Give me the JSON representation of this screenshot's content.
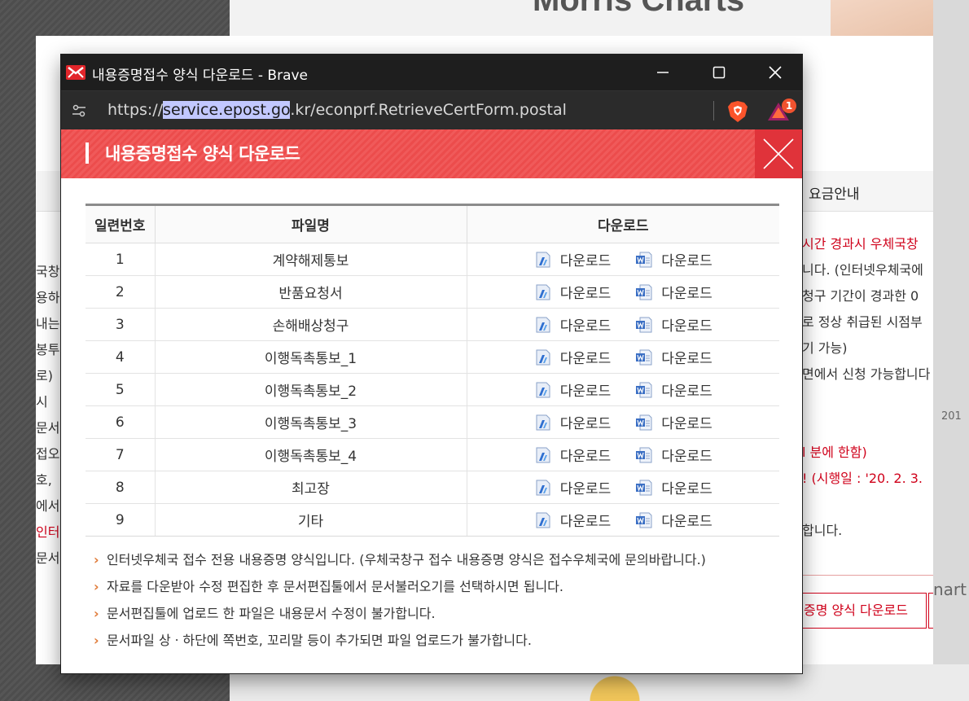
{
  "background": {
    "top_title": "Morris Charts",
    "tab_label": "요금안내",
    "left_fragments": [
      "국창",
      "용하",
      "내는",
      "봉투",
      "로)",
      "시",
      "문서",
      "접오",
      "호,",
      "에서",
      "인터",
      "문서"
    ],
    "right_lines": [
      {
        "text": "시간 경과시 우체국창",
        "red": true
      },
      {
        "text": "니다. (인터넷우체국에",
        "red": false
      },
      {
        "text": "청구 기간이 경과한 0",
        "red": false
      },
      {
        "text": "로 정상 취급된 시점부",
        "red": false
      },
      {
        "text": "기 가능)",
        "red": false
      },
      {
        "text": "면에서 신청 가능합니다",
        "red": false
      },
      {
        "text": "",
        "red": false
      },
      {
        "text": "",
        "red": false
      },
      {
        "text": "l 분에 한함)",
        "red": true
      },
      {
        "text": "! (시행일 : '20. 2. 3.",
        "red": true
      },
      {
        "text": "",
        "red": false
      },
      {
        "text": "합니다.",
        "red": false
      }
    ],
    "year_label": "201",
    "side_text": "nart",
    "bottom_button": "증명 양식 다운로드"
  },
  "window": {
    "title": "내용증명접수 양식 다운로드 - Brave",
    "url_prefix": "https://",
    "url_selected": "service.epost.go",
    "url_suffix": ".kr/econprf.RetrieveCertForm.postal",
    "rewards_badge": "1",
    "icons": {
      "app": "epost-logo-icon",
      "site_settings": "tune-icon",
      "brave": "brave-shield-icon",
      "rewards": "brave-rewards-icon"
    }
  },
  "popup": {
    "title": "내용증명접수 양식 다운로드",
    "header_color": "#ee5050",
    "close_color": "#e0333a",
    "table": {
      "headers": [
        "일련번호",
        "파일명",
        "다운로드"
      ],
      "rows": [
        {
          "no": "1",
          "name": "계약해제통보"
        },
        {
          "no": "2",
          "name": "반품요청서"
        },
        {
          "no": "3",
          "name": "손해배상청구"
        },
        {
          "no": "4",
          "name": "이행독촉통보_1"
        },
        {
          "no": "5",
          "name": "이행독촉통보_2"
        },
        {
          "no": "6",
          "name": "이행독촉통보_3"
        },
        {
          "no": "7",
          "name": "이행독촉통보_4"
        },
        {
          "no": "8",
          "name": "최고장"
        },
        {
          "no": "9",
          "name": "기타"
        }
      ],
      "download_label_hwp": "다운로드",
      "download_label_word": "다운로드"
    },
    "notes": [
      "인터넷우체국 접수 전용 내용증명 양식입니다. (우체국창구 접수 내용증명 양식은 접수우체국에 문의바랍니다.)",
      "자료를 다운받아 수정 편집한 후 문서편집툴에서 문서불러오기를 선택하시면 됩니다.",
      "문서편집툴에 업로드 한 파일은 내용문서 수정이 불가합니다.",
      "문서파일 상ㆍ하단에 쪽번호, 꼬리말 등이 추가되면 파일 업로드가 불가합니다."
    ]
  }
}
